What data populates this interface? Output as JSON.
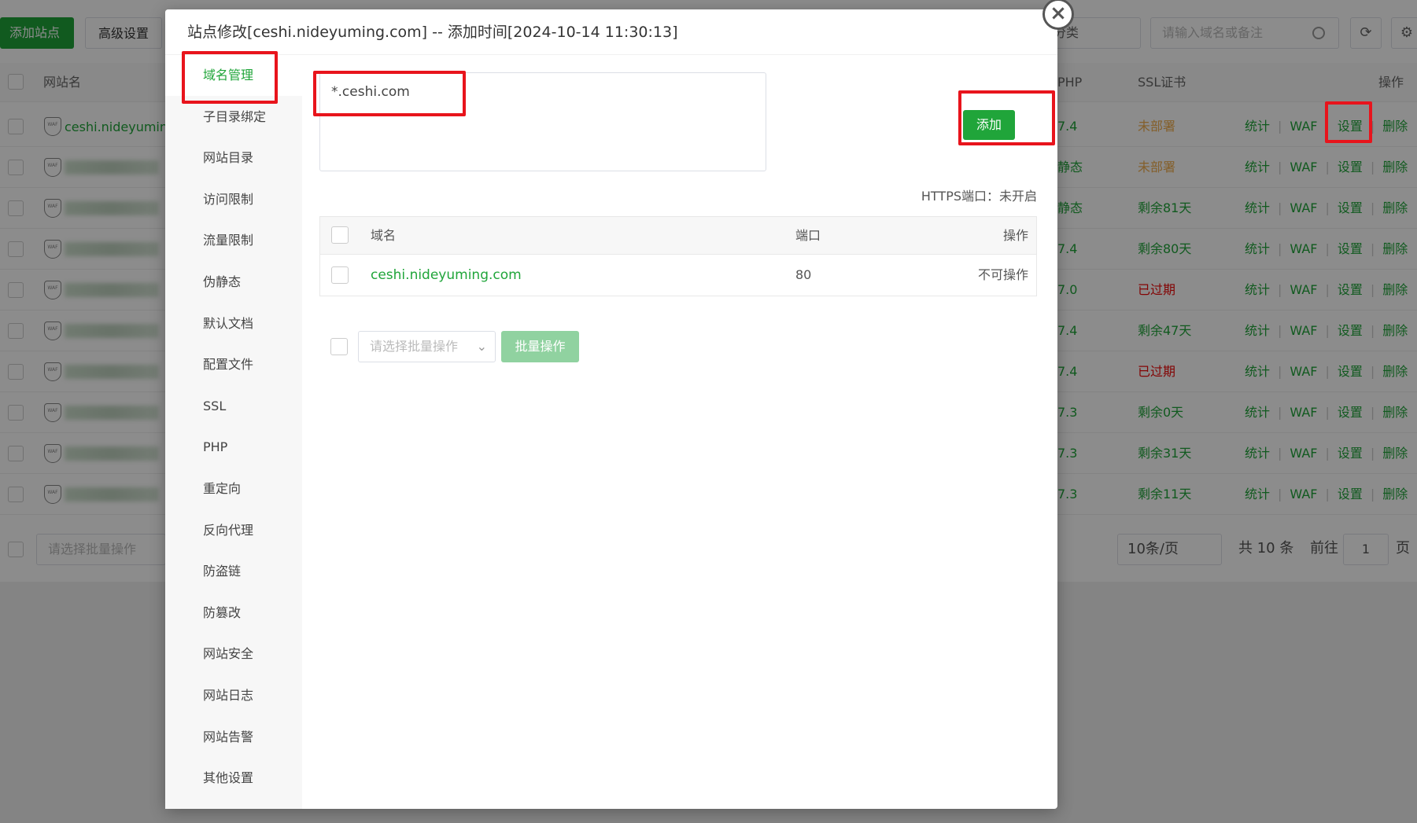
{
  "background": {
    "toolbar": {
      "add_site": "添加站点",
      "advanced": "高级设置",
      "category_select": "分类",
      "search_placeholder": "请输入域名或备注"
    },
    "table": {
      "headers": {
        "site_name": "网站名",
        "php": "PHP",
        "ssl": "SSL证书",
        "ops": "操作"
      },
      "first_site": "ceshi.nideyuming",
      "waf_badge": "WAF",
      "rows": [
        {
          "php": "7.4",
          "ssl": "未部署",
          "ssl_status": "warn"
        },
        {
          "php": "静态",
          "ssl": "未部署",
          "ssl_status": "warn"
        },
        {
          "php": "静态",
          "ssl": "剩余81天",
          "ssl_status": "ok"
        },
        {
          "php": "7.4",
          "ssl": "剩余80天",
          "ssl_status": "ok"
        },
        {
          "php": "7.0",
          "ssl": "已过期",
          "ssl_status": "bad"
        },
        {
          "php": "7.4",
          "ssl": "剩余47天",
          "ssl_status": "ok"
        },
        {
          "php": "7.4",
          "ssl": "已过期",
          "ssl_status": "bad"
        },
        {
          "php": "7.3",
          "ssl": "剩余0天",
          "ssl_status": "ok"
        },
        {
          "php": "7.3",
          "ssl": "剩余31天",
          "ssl_status": "ok"
        },
        {
          "php": "7.3",
          "ssl": "剩余11天",
          "ssl_status": "ok"
        }
      ],
      "ops": {
        "stats": "统计",
        "waf": "WAF",
        "settings": "设置",
        "delete": "删除"
      }
    },
    "footer": {
      "batch_placeholder": "请选择批量操作",
      "page_size": "10条/页",
      "total": "共 10 条",
      "goto": "前往",
      "page": "1",
      "page_unit": "页"
    }
  },
  "modal": {
    "title": "站点修改[ceshi.nideyuming.com] -- 添加时间[2024-10-14 11:30:13]",
    "close_icon": "×",
    "nav": [
      "域名管理",
      "子目录绑定",
      "网站目录",
      "访问限制",
      "流量限制",
      "伪静态",
      "默认文档",
      "配置文件",
      "SSL",
      "PHP",
      "重定向",
      "反向代理",
      "防盗链",
      "防篡改",
      "网站安全",
      "网站日志",
      "网站告警",
      "其他设置"
    ],
    "active_nav": "域名管理",
    "domain_input_value": "*.ceshi.com",
    "add_button": "添加",
    "https_label": "HTTPS端口：未开启",
    "domain_table": {
      "headers": {
        "domain": "域名",
        "port": "端口",
        "ops": "操作"
      },
      "rows": [
        {
          "domain": "ceshi.nideyuming.com",
          "port": "80",
          "ops": "不可操作"
        }
      ]
    },
    "batch_placeholder": "请选择批量操作",
    "batch_button": "批量操作"
  },
  "colors": {
    "accent": "#20a53a",
    "annotation": "#e8141c",
    "expired": "#ef0808",
    "warning": "#f0ad4e"
  }
}
